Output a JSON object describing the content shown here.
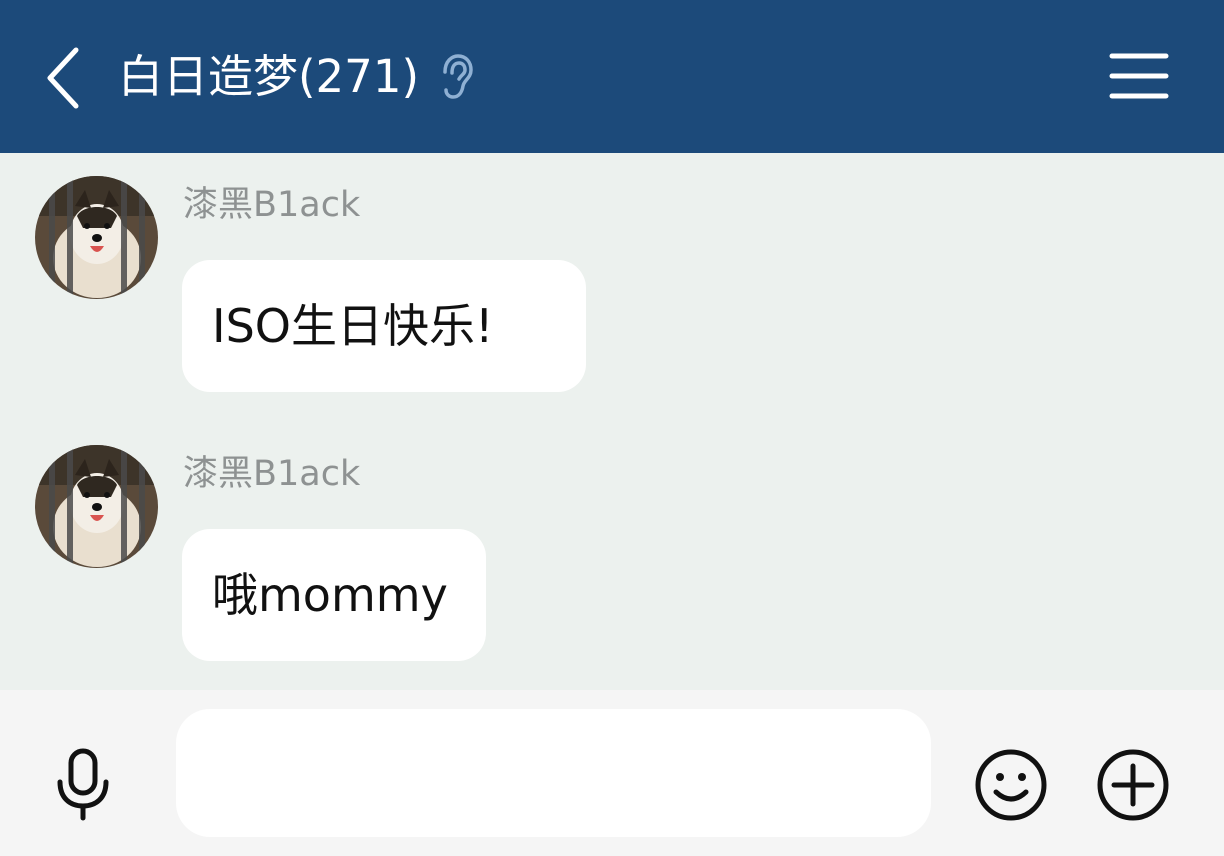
{
  "header": {
    "title": "白日造梦(271)",
    "back_icon": "chevron-left-icon",
    "ear_icon": "ear-icon",
    "menu_icon": "hamburger-menu-icon",
    "background_color": "#1c4a7a"
  },
  "messages": [
    {
      "sender": "漆黑B1ack",
      "text": "ISO生日快乐!",
      "avatar": "dog-avatar"
    },
    {
      "sender": "漆黑B1ack",
      "text": "哦mommy",
      "avatar": "dog-avatar"
    }
  ],
  "input_bar": {
    "input_value": "",
    "mic_icon": "microphone-icon",
    "emoji_icon": "smiley-icon",
    "plus_icon": "plus-circle-icon"
  },
  "colors": {
    "chat_background": "#ecf1ee",
    "bubble": "#ffffff",
    "sender_name": "#8e9292"
  }
}
